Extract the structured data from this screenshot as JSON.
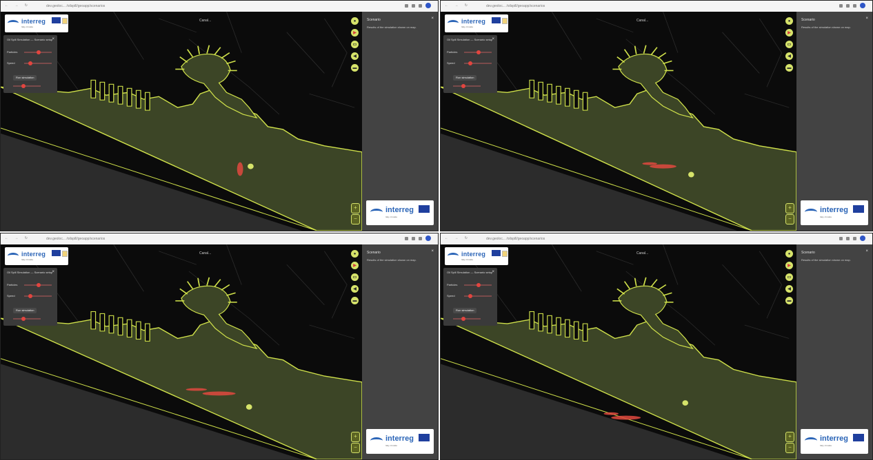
{
  "browser": {
    "nav_icons": "← → ↻",
    "url_text": "dev.geoloc... /oilspill/geoapp/scenarios"
  },
  "logo": {
    "wordmark": "interreg",
    "tagline": "Italy–Croatia"
  },
  "control_panel": {
    "title": "Oil Spill Simulation — Scenario setup",
    "close": "×",
    "row1_label": "Particles",
    "row2_label": "Speed",
    "button_label": "Run simulation"
  },
  "map": {
    "place_name": "Canal..."
  },
  "map_controls": {
    "icons": [
      "circle-icon",
      "play-icon",
      "chat-icon",
      "back-icon",
      "layers-icon"
    ],
    "glyphs": [
      "●",
      "▶",
      "▭",
      "◀",
      "▬"
    ],
    "zoom_in": "+",
    "zoom_out": "−"
  },
  "sidebar": {
    "title": "Scenario",
    "close": "×",
    "description": "Results of the simulation shown on map."
  },
  "colors": {
    "land_overlay": "#3c4526",
    "coast_line": "#cfe04a",
    "spill": "#e0493f",
    "accent_green": "#d6e36a"
  },
  "panels": [
    {
      "id": "top-left",
      "spill_stage": 0
    },
    {
      "id": "top-right",
      "spill_stage": 1
    },
    {
      "id": "bottom-left",
      "spill_stage": 2
    },
    {
      "id": "bottom-right",
      "spill_stage": 3
    }
  ]
}
